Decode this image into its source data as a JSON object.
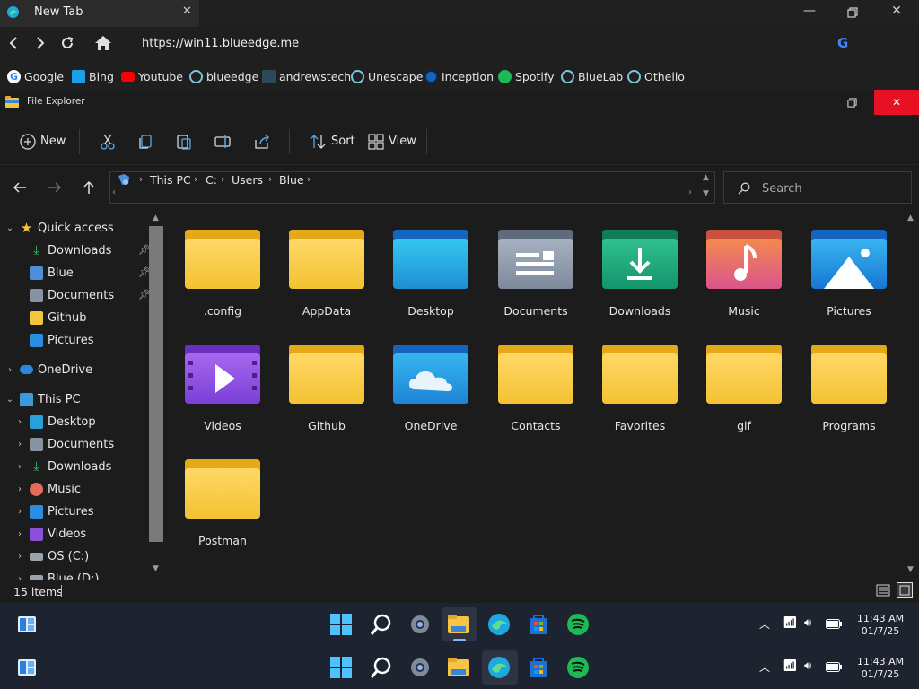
{
  "browser": {
    "tab_title": "New Tab",
    "url": "https://win11.blueedge.me",
    "bookmarks": [
      "Google",
      "Bing",
      "Youtube",
      "blueedge",
      "andrewstech",
      "Unescape",
      "Inception",
      "Spotify",
      "BlueLab",
      "Othello"
    ]
  },
  "explorer": {
    "window_title": "File Explorer",
    "commands": {
      "new": "New",
      "sort": "Sort",
      "view": "View"
    },
    "breadcrumb": [
      "This PC",
      "C:",
      "Users",
      "Blue"
    ],
    "search_placeholder": "Search",
    "nav": {
      "quick_access": "Quick access",
      "quick_items": [
        "Downloads",
        "Blue",
        "Documents",
        "Github",
        "Pictures"
      ],
      "onedrive": "OneDrive",
      "this_pc": "This PC",
      "pc_items": [
        "Desktop",
        "Documents",
        "Downloads",
        "Music",
        "Pictures",
        "Videos",
        "OS (C:)",
        "Blue (D:)"
      ]
    },
    "items": [
      ".config",
      "AppData",
      "Desktop",
      "Documents",
      "Downloads",
      "Music",
      "Pictures",
      "Videos",
      "Github",
      "OneDrive",
      "Contacts",
      "Favorites",
      "gif",
      "Programs",
      "Postman"
    ],
    "status": "15 items"
  },
  "taskbar": {
    "time": "11:43 AM",
    "date": "01/7/25"
  }
}
